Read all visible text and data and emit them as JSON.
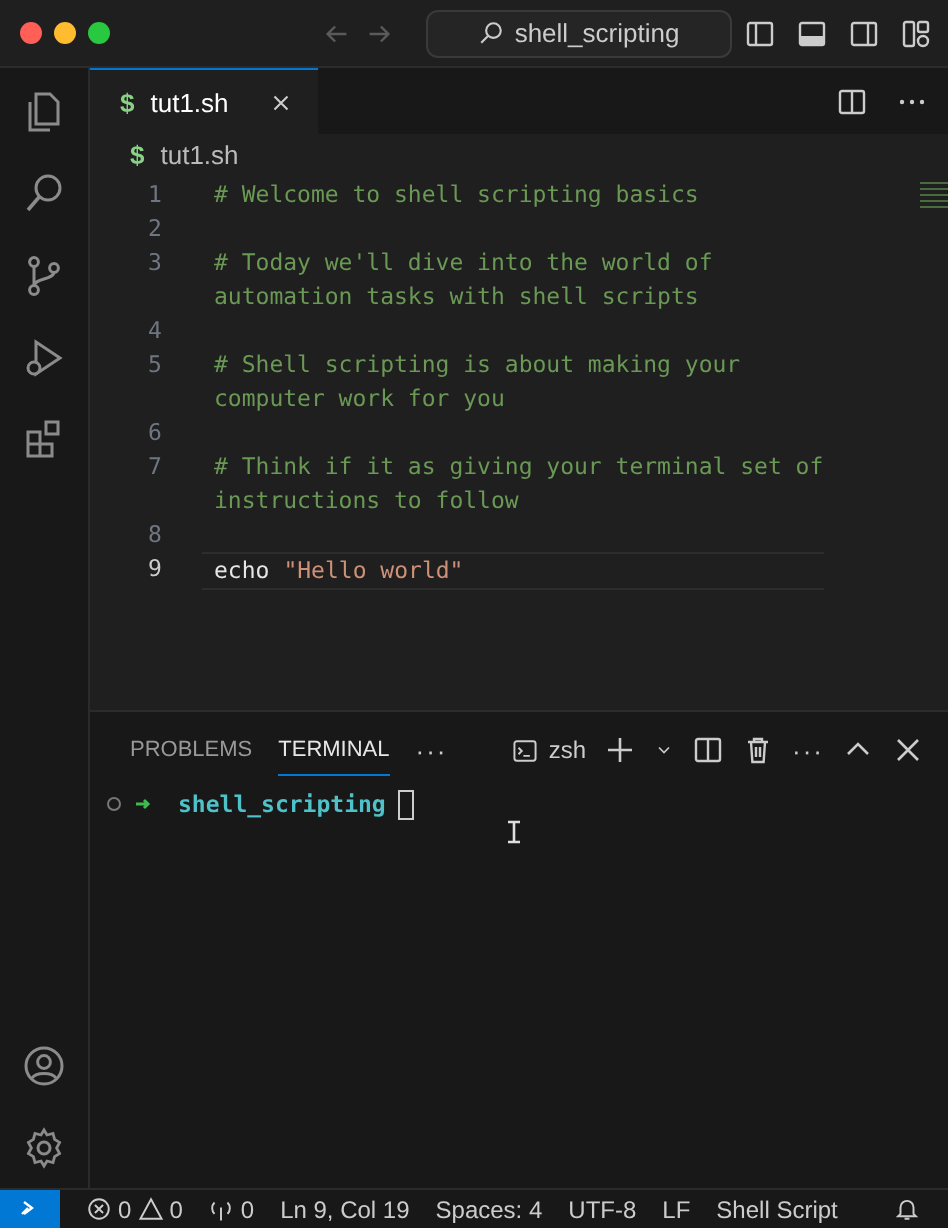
{
  "titlebar": {
    "search": "shell_scripting"
  },
  "tabs": [
    {
      "icon": "$",
      "label": "tut1.sh",
      "selected": true
    }
  ],
  "breadcrumb": {
    "icon": "$",
    "label": "tut1.sh"
  },
  "lines": [
    {
      "number": "1",
      "active": false,
      "tokens": [
        {
          "kind": "comment",
          "rows": [
            "# Welcome to shell scripting basics"
          ]
        }
      ]
    },
    {
      "number": "2",
      "active": false
    },
    {
      "number": "3",
      "active": false,
      "tokens": [
        {
          "kind": "comment",
          "rows": [
            "# Today we'll dive into the world of",
            "automation tasks with shell scripts"
          ]
        }
      ]
    },
    {
      "number": "4",
      "active": false
    },
    {
      "number": "5",
      "active": false,
      "tokens": [
        {
          "kind": "comment",
          "rows": [
            "# Shell scripting is about making your",
            "computer work for you"
          ]
        }
      ]
    },
    {
      "number": "6",
      "active": false
    },
    {
      "number": "7",
      "active": false,
      "tokens": [
        {
          "kind": "comment",
          "rows": [
            "# Think if it as giving your terminal set of",
            "instructions to follow"
          ]
        }
      ]
    },
    {
      "number": "8",
      "active": false
    },
    {
      "number": "9",
      "active": true,
      "tokens": [
        {
          "kind": "keyword",
          "rows": [
            "echo"
          ]
        },
        {
          "kind": "string",
          "rows": [
            "\"Hello world\""
          ]
        }
      ]
    }
  ],
  "panel": {
    "tabs": [
      {
        "label": "PROBLEMS",
        "selected": false
      },
      {
        "label": "TERMINAL",
        "selected": true
      }
    ],
    "more": "···",
    "shell": "zsh",
    "more2": "···"
  },
  "terminal": {
    "prompt": "shell_scripting"
  },
  "status": {
    "errors": "0",
    "warnings": "0",
    "ports": "0",
    "position": "Ln 9, Col 19",
    "spaces": "Spaces: 4",
    "encoding": "UTF-8",
    "eol": "LF",
    "language": "Shell Script"
  }
}
